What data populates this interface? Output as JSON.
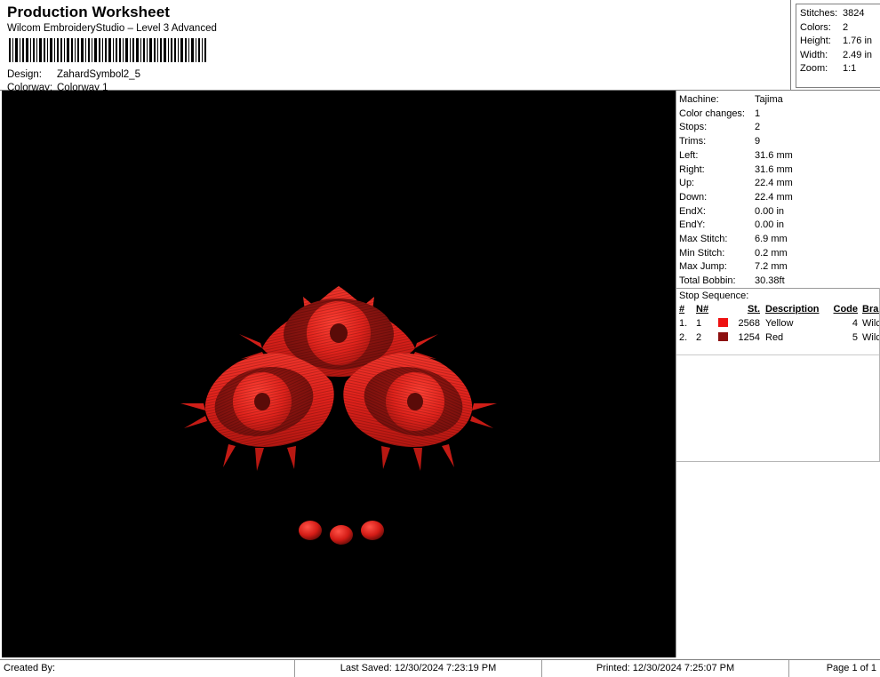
{
  "header": {
    "title": "Production Worksheet",
    "app_name": "Wilcom EmbroideryStudio – Level 3 Advanced",
    "barcode_icon": "barcode",
    "design_label": "Design:",
    "design_value": "ZahardSymbol2_5",
    "colorway_label": "Colorway:",
    "colorway_value": "Colorway 1"
  },
  "stats": {
    "rows": [
      {
        "label": "Stitches:",
        "value": "3824"
      },
      {
        "label": "Colors:",
        "value": "2"
      },
      {
        "label": "Height:",
        "value": "1.76 in"
      },
      {
        "label": "Width:",
        "value": "2.49 in"
      },
      {
        "label": "Zoom:",
        "value": "1:1"
      }
    ]
  },
  "machine_info": {
    "rows": [
      {
        "label": "Machine:",
        "value": "Tajima"
      },
      {
        "label": "Color changes:",
        "value": "1"
      },
      {
        "label": "Stops:",
        "value": "2"
      },
      {
        "label": "Trims:",
        "value": "9"
      },
      {
        "label": "Left:",
        "value": "31.6 mm"
      },
      {
        "label": "Right:",
        "value": "31.6 mm"
      },
      {
        "label": "Up:",
        "value": "22.4 mm"
      },
      {
        "label": "Down:",
        "value": "22.4 mm"
      },
      {
        "label": "EndX:",
        "value": "0.00 in"
      },
      {
        "label": "EndY:",
        "value": "0.00 in"
      },
      {
        "label": "Max Stitch:",
        "value": "6.9 mm"
      },
      {
        "label": "Min Stitch:",
        "value": "0.2 mm"
      },
      {
        "label": "Max Jump:",
        "value": "7.2 mm"
      },
      {
        "label": "Total Bobbin:",
        "value": "30.38ft"
      }
    ]
  },
  "stop_sequence": {
    "title": "Stop Sequence:",
    "columns": [
      "#",
      "N#",
      "",
      "St.",
      "Description",
      "Code",
      "Brand"
    ],
    "rows": [
      {
        "idx": "1.",
        "n": "1",
        "swatch": "#EE1111",
        "stitches": "2568",
        "description": "Yellow",
        "code": "4",
        "brand": "Wilcom"
      },
      {
        "idx": "2.",
        "n": "2",
        "swatch": "#8C0F0F",
        "stitches": "1254",
        "description": "Red",
        "code": "5",
        "brand": "Wilcom"
      }
    ]
  },
  "design_preview": {
    "background": "#000000",
    "thread_bright": "#E8201A",
    "thread_mid": "#C21E18",
    "thread_dark": "#8A1410",
    "pupil": "#5A0B08",
    "motif_name": "three-eye-symbol"
  },
  "footer": {
    "created_by": "Created By:",
    "last_saved": "Last Saved: 12/30/2024 7:23:19 PM",
    "printed": "Printed: 12/30/2024 7:25:07 PM",
    "page": "Page 1 of 1"
  }
}
